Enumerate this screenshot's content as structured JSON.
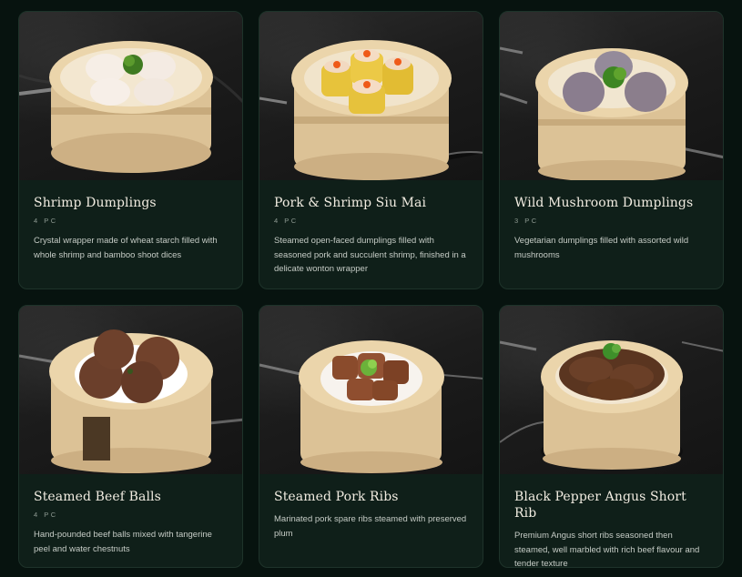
{
  "menu": {
    "items": [
      {
        "title": "Shrimp Dumplings",
        "quantity": "4 PC",
        "description": "Crystal wrapper made of wheat starch filled with whole shrimp and bamboo shoot dices",
        "image_icon": "shrimp-dumpling-icon"
      },
      {
        "title": "Pork & Shrimp Siu Mai",
        "quantity": "4 PC",
        "description": "Steamed open-faced dumplings filled with seasoned pork and succulent shrimp, finished in a delicate wonton wrapper",
        "image_icon": "siu-mai-icon"
      },
      {
        "title": "Wild Mushroom Dumplings",
        "quantity": "3 PC",
        "description": "Vegetarian dumplings filled with assorted wild mushrooms",
        "image_icon": "mushroom-dumpling-icon"
      },
      {
        "title": "Steamed Beef Balls",
        "quantity": "4 PC",
        "description": "Hand-pounded beef balls mixed with tangerine peel and water chestnuts",
        "image_icon": "beef-ball-icon"
      },
      {
        "title": "Steamed Pork Ribs",
        "quantity": "",
        "description": "Marinated pork spare ribs steamed with preserved plum",
        "image_icon": "pork-ribs-icon"
      },
      {
        "title": "Black Pepper Angus Short Rib",
        "quantity": "",
        "description": "Premium Angus short ribs seasoned then steamed, well marbled with rich beef flavour and tender texture",
        "image_icon": "short-rib-icon"
      }
    ]
  },
  "colors": {
    "page_background": "#07130f",
    "card_background": "#0f1f19",
    "bamboo": "#e7cfa3",
    "title_text": "#f1ece1"
  }
}
